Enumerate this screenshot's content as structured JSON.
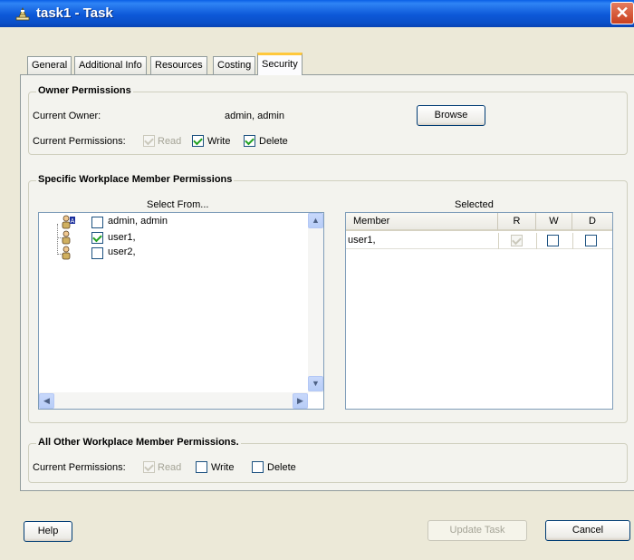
{
  "window": {
    "title": "task1 - Task",
    "icon": "task-icon",
    "close_label": "✕"
  },
  "tabs": [
    {
      "label": "General"
    },
    {
      "label": "Additional Info"
    },
    {
      "label": "Resources"
    },
    {
      "label": "Costing"
    },
    {
      "label": "Security",
      "active": true
    }
  ],
  "owner": {
    "group_title": "Owner Permissions",
    "current_owner_label": "Current Owner:",
    "current_owner_value": "admin, admin",
    "browse_label": "Browse",
    "permissions_label": "Current Permissions:",
    "read": {
      "label": "Read",
      "checked": true,
      "enabled": false
    },
    "write": {
      "label": "Write",
      "checked": true
    },
    "delete": {
      "label": "Delete",
      "checked": true
    }
  },
  "specific": {
    "group_title": "Specific Workplace Member Permissions",
    "select_from_label": "Select From...",
    "selected_label": "Selected",
    "members": [
      {
        "name": "admin, admin",
        "checked": false,
        "icon": "user-admin-icon"
      },
      {
        "name": "user1,",
        "checked": true,
        "icon": "user-icon"
      },
      {
        "name": "user2,",
        "checked": false,
        "icon": "user-icon"
      }
    ],
    "table": {
      "columns": [
        "Member",
        "R",
        "W",
        "D"
      ],
      "rows": [
        {
          "member": "user1,",
          "r": true,
          "w": false,
          "d": false
        }
      ]
    }
  },
  "other": {
    "group_title": "All Other Workplace Member Permissions.",
    "permissions_label": "Current Permissions:",
    "read": {
      "label": "Read",
      "checked": true,
      "enabled": false
    },
    "write": {
      "label": "Write",
      "checked": false
    },
    "delete": {
      "label": "Delete",
      "checked": false
    }
  },
  "footer": {
    "help_label": "Help",
    "update_label": "Update Task",
    "cancel_label": "Cancel"
  },
  "colors": {
    "titlebar": "#0a5fe6",
    "active_tab_accent": "#ffc83c",
    "check": "#21a121"
  }
}
